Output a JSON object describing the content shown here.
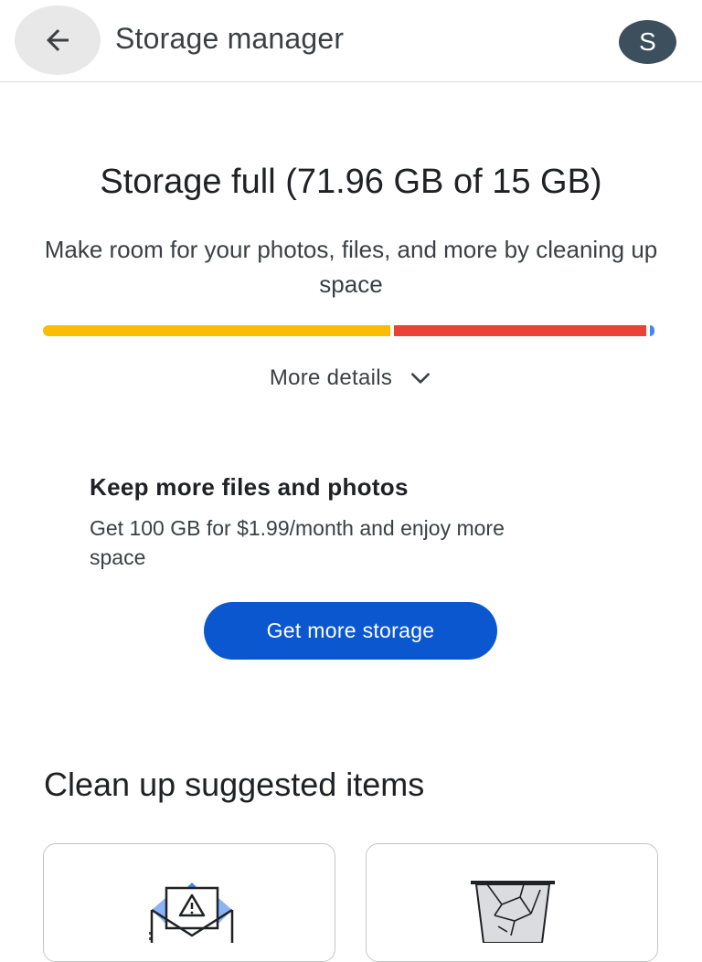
{
  "header": {
    "title": "Storage manager",
    "back_icon": "arrow-back-icon",
    "avatar_initial": "S"
  },
  "storage": {
    "title": "Storage full (71.96 GB of 15 GB)",
    "subtitle": "Make room for your photos, files, and more by cleaning up space",
    "used_gb": 71.96,
    "quota_gb": 15,
    "segments": [
      {
        "name": "yellow",
        "color": "#fbbc04",
        "fraction": 0.57
      },
      {
        "name": "red",
        "color": "#ea4335",
        "fraction": 0.415
      },
      {
        "name": "blue",
        "color": "#4285f4",
        "fraction": 0.008
      }
    ],
    "details_label": "More details",
    "details_icon": "chevron-down-icon"
  },
  "promo": {
    "title": "Keep more files and photos",
    "text": "Get 100 GB for $1.99/month and enjoy more space",
    "button_label": "Get more storage",
    "button_color": "#0b57d0"
  },
  "cleanup": {
    "title": "Clean up suggested items",
    "cards": [
      {
        "icon": "spam-mail-icon"
      },
      {
        "icon": "trash-bin-icon"
      }
    ]
  }
}
